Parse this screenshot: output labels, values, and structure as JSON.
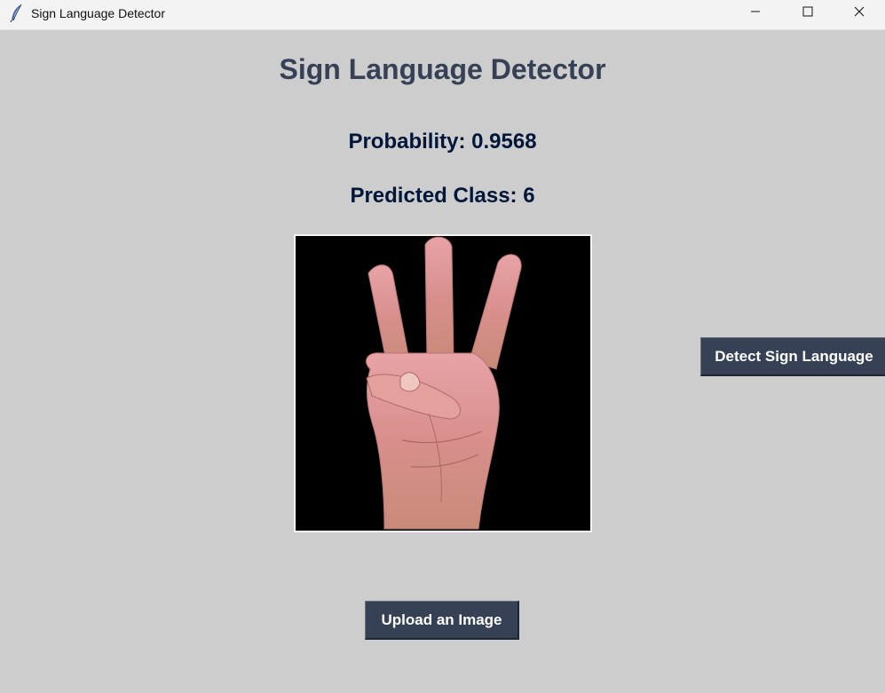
{
  "window": {
    "title": "Sign Language Detector",
    "controls": {
      "minimize_icon": "minimize-icon",
      "maximize_icon": "maximize-icon",
      "close_icon": "close-icon"
    }
  },
  "main": {
    "heading": "Sign Language Detector",
    "probability_text": "Probability: 0.9568",
    "predicted_class_text": "Predicted Class: 6",
    "image": {
      "description": "hand-sign-image",
      "icon": "hand-image"
    },
    "detect_button_label": "Detect Sign Language",
    "upload_button_label": "Upload an Image"
  },
  "colors": {
    "background": "#cdcdcd",
    "heading": "#364156",
    "result_text": "#011638",
    "button_bg": "#364156",
    "button_text": "#ffffff"
  }
}
